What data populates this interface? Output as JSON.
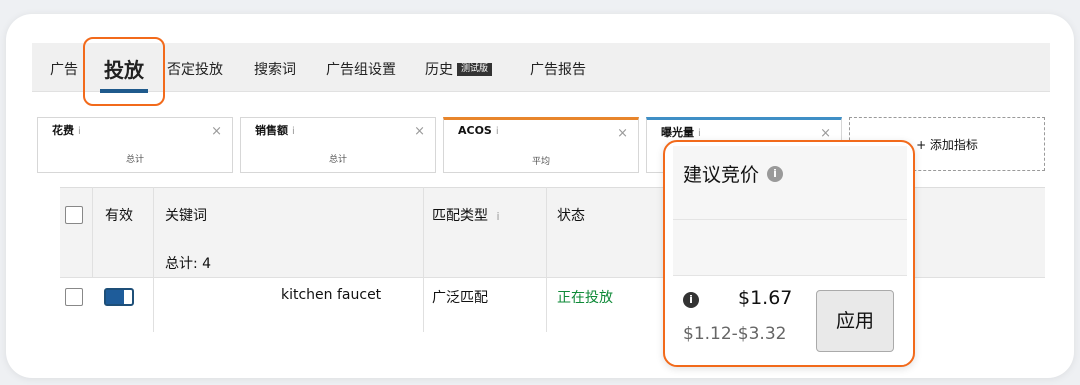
{
  "tabs": [
    {
      "label": "广告"
    },
    {
      "label": "投放"
    },
    {
      "label": "否定投放"
    },
    {
      "label": "搜索词"
    },
    {
      "label": "广告组设置"
    },
    {
      "label": "历史",
      "badge": "测试版"
    },
    {
      "label": "广告报告"
    }
  ],
  "metrics": [
    {
      "label": "花费",
      "aggregation": "总计"
    },
    {
      "label": "销售额",
      "aggregation": "总计"
    },
    {
      "label": "ACOS",
      "aggregation": "平均"
    },
    {
      "label": "曝光量",
      "aggregation": ""
    }
  ],
  "add_metric_label": "+ 添加指标",
  "info_glyph": "i",
  "close_glyph": "×",
  "table": {
    "columns": {
      "enabled": "有效",
      "keyword": "关键词",
      "match_type": "匹配类型",
      "status": "状态"
    },
    "total_label": "总计: 4",
    "rows": [
      {
        "keyword": "kitchen faucet",
        "match_type": "广泛匹配",
        "status": "正在投放"
      }
    ]
  },
  "popup": {
    "title": "建议竞价",
    "suggested_bid": "$1.67",
    "bid_range": "$1.12-$3.32",
    "apply_label": "应用"
  },
  "colors": {
    "highlight": "#f26a1b",
    "acos_accent": "#e8852b",
    "impressions_accent": "#3f8fc6",
    "status_green": "#0f8a38",
    "tab_underline": "#1f5a8c"
  }
}
